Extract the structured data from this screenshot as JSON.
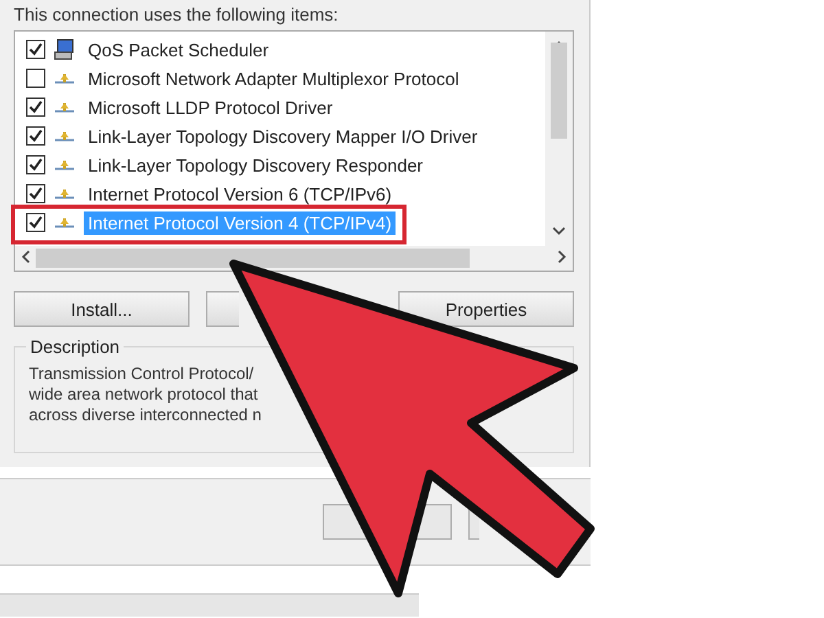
{
  "header": "This connection uses the following items:",
  "items": [
    {
      "label": "QoS Packet Scheduler",
      "kind": "service",
      "checked": true,
      "selected": false,
      "highlighted": false
    },
    {
      "label": "Microsoft Network Adapter Multiplexor Protocol",
      "kind": "protocol",
      "checked": false,
      "selected": false,
      "highlighted": false
    },
    {
      "label": "Microsoft LLDP Protocol Driver",
      "kind": "protocol",
      "checked": true,
      "selected": false,
      "highlighted": false
    },
    {
      "label": "Link-Layer Topology Discovery Mapper I/O Driver",
      "kind": "protocol",
      "checked": true,
      "selected": false,
      "highlighted": false
    },
    {
      "label": "Link-Layer Topology Discovery Responder",
      "kind": "protocol",
      "checked": true,
      "selected": false,
      "highlighted": false
    },
    {
      "label": "Internet Protocol Version 6 (TCP/IPv6)",
      "kind": "protocol",
      "checked": true,
      "selected": false,
      "highlighted": false
    },
    {
      "label": "Internet Protocol Version 4 (TCP/IPv4)",
      "kind": "protocol",
      "checked": true,
      "selected": true,
      "highlighted": true
    }
  ],
  "buttons": [
    {
      "label": "Install..."
    },
    {
      "label": "Properties"
    }
  ],
  "description": {
    "title": "Description",
    "lines": [
      "Transmission Control Protocol/",
      "wide area network protocol that",
      "across diverse interconnected n"
    ]
  }
}
